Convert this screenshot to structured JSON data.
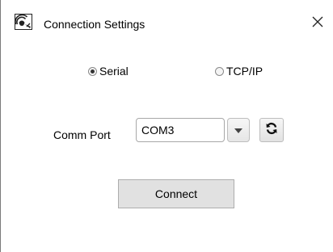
{
  "window": {
    "title": "Connection Settings",
    "icon": "connection-app-icon",
    "close_icon": "close-icon"
  },
  "connection_type": {
    "options": [
      {
        "label": "Serial",
        "selected": true
      },
      {
        "label": "TCP/IP",
        "selected": false
      }
    ]
  },
  "comm_port": {
    "label": "Comm Port",
    "value": "COM3",
    "dropdown_icon": "chevron-down-icon",
    "refresh_icon": "refresh-icon"
  },
  "actions": {
    "connect_label": "Connect"
  },
  "colors": {
    "window_bg": "#ffffff",
    "button_bg": "#e1e1e1",
    "border": "#adadad"
  }
}
